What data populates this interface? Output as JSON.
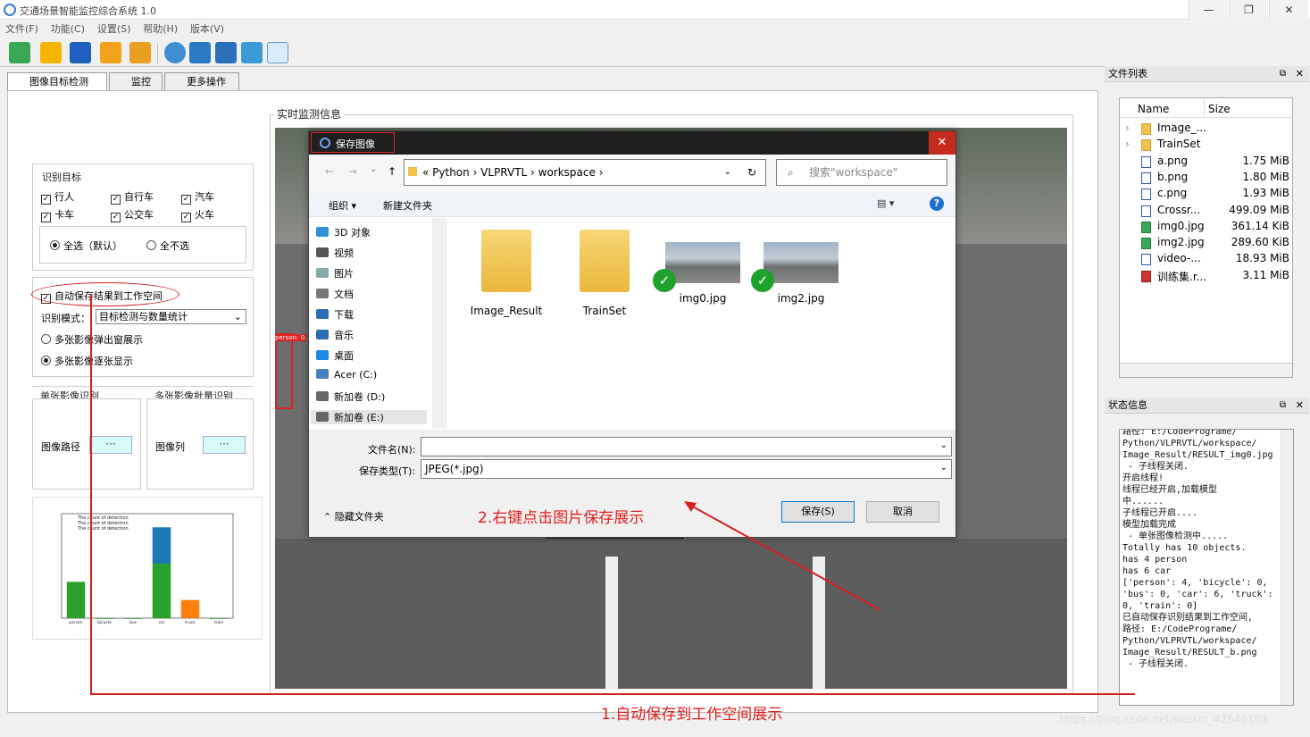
{
  "window": {
    "title": "交通场景智能监控综合系统 1.0",
    "min": "—",
    "restore": "❐",
    "close": "✕"
  },
  "menu": [
    "文件(F)",
    "功能(C)",
    "设置(S)",
    "帮助(H)",
    "版本(V)"
  ],
  "tabs": [
    {
      "label": "图像目标检测"
    },
    {
      "label": "监控"
    },
    {
      "label": "更多操作"
    }
  ],
  "targets": {
    "title": "识别目标",
    "items": [
      "行人",
      "自行车",
      "汽车",
      "卡车",
      "公交车",
      "火车"
    ],
    "select_all": "全选（默认）",
    "select_none": "全不选"
  },
  "options": {
    "auto_save": "自动保存结果到工作空间",
    "mode_label": "识别模式：",
    "mode_value": "目标检测与数量统计",
    "popup": "多张影像弹出窗展示",
    "stepwise": "多张影像逐张显示"
  },
  "single": {
    "title": "单张影像识别",
    "path_label": "图像路径",
    "btn": "···"
  },
  "batch": {
    "title": "多张影像批量识别",
    "path_label": "图像列",
    "btn": "···"
  },
  "chart": {
    "legend": [
      "The count of detection",
      "The count of detection",
      "The count of detection"
    ],
    "categories": [
      "person",
      "bicycle",
      "bus",
      "car",
      "truck",
      "train"
    ],
    "values_total": [
      4,
      0,
      0,
      10,
      2,
      0
    ],
    "values_a": [
      4,
      0,
      0,
      6,
      2,
      0
    ],
    "colors": {
      "a": "#2ca02c",
      "b": "#1f77b4",
      "c": "#ff7f0e"
    }
  },
  "monitor": {
    "title": "实时监测信息",
    "label": "person: 0."
  },
  "dialog": {
    "title": "保存图像",
    "breadcrumb": [
      "«",
      "Python",
      "›",
      "VLPRVTL",
      "›",
      "workspace",
      "›"
    ],
    "search_placeholder": "搜索\"workspace\"",
    "organize": "组织 ▾",
    "new_folder": "新建文件夹",
    "nav": [
      "3D 对象",
      "视频",
      "图片",
      "文档",
      "下载",
      "音乐",
      "桌面",
      "Acer (C:)",
      "新加卷 (D:)",
      "新加卷 (E:)"
    ],
    "files": [
      {
        "name": "Image_Result"
      },
      {
        "name": "TrainSet"
      },
      {
        "name": "img0.jpg"
      },
      {
        "name": "img2.jpg"
      }
    ],
    "filename_label": "文件名(N):",
    "filename_value": "",
    "type_label": "保存类型(T):",
    "type_value": "JPEG(*.jpg)",
    "hide_folders": "隐藏文件夹",
    "save": "保存(S)",
    "cancel": "取消"
  },
  "filelist": {
    "title": "文件列表",
    "col_name": "Name",
    "col_size": "Size",
    "rows": [
      {
        "name": "Image_...",
        "size": ""
      },
      {
        "name": "TrainSet",
        "size": ""
      },
      {
        "name": "a.png",
        "size": "1.75 MiB"
      },
      {
        "name": "b.png",
        "size": "1.80 MiB"
      },
      {
        "name": "c.png",
        "size": "1.93 MiB"
      },
      {
        "name": "Crossr...",
        "size": "499.09 MiB"
      },
      {
        "name": "img0.jpg",
        "size": "361.14 KiB"
      },
      {
        "name": "img2.jpg",
        "size": "289.60 KiB"
      },
      {
        "name": "video-...",
        "size": "18.93 MiB"
      },
      {
        "name": "训练集.r...",
        "size": "3.11 MiB"
      }
    ]
  },
  "status": {
    "title": "状态信息",
    "lines": [
      "路径: E:/CodePrograme/",
      "Python/VLPRVTL/workspace/",
      "Image_Result/RESULT_img0.jpg",
      " - 子线程关闭.",
      "",
      "开启线程!",
      "线程已经开启,加载模型",
      "中......",
      "子线程已开启....",
      "模型加载完成",
      "",
      " - 单张图像检测中.....",
      "Totally has 10 objects.",
      "has 4 person",
      "has 6 car",
      "['person': 4, 'bicycle': 0,",
      "'bus': 0, 'car': 6, 'truck':",
      "0, 'train': 0]",
      "已自动保存识别结果到工作空间,",
      "路径: E:/CodePrograme/",
      "Python/VLPRVTL/workspace/",
      "Image_Result/RESULT_b.png",
      " - 子线程关闭."
    ]
  },
  "annotations": {
    "a1": "1.自动保存到工作空间展示",
    "a2": "2.右键点击图片保存展示"
  },
  "watermark": "https://blog.csdn.net/weixin_42646103"
}
